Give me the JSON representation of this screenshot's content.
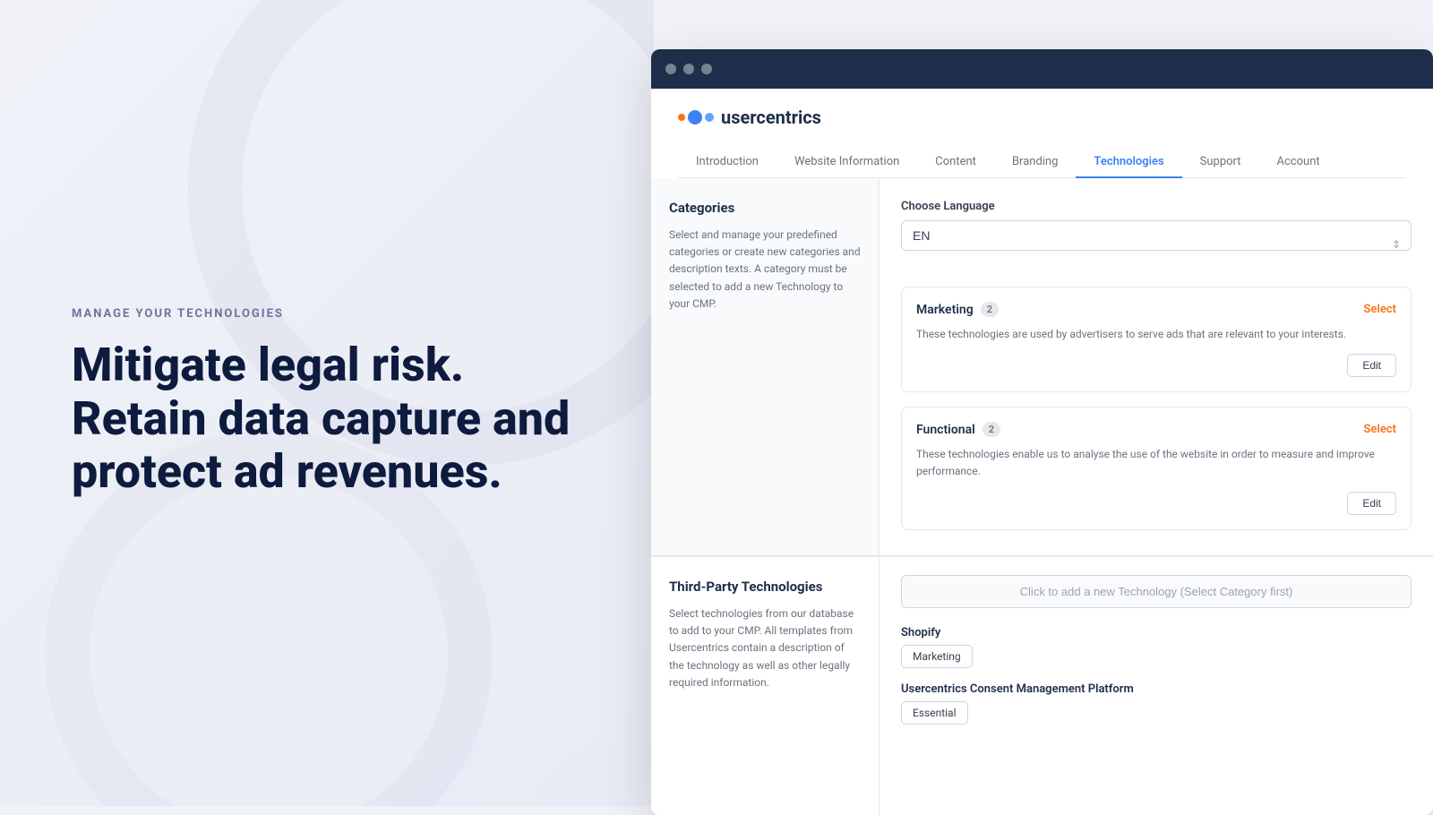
{
  "left": {
    "eyebrow": "MANAGE YOUR TECHNOLOGIES",
    "headline": "Mitigate legal risk. Retain data capture and protect ad revenues."
  },
  "browser": {
    "titlebar": {
      "dots": [
        "dot1",
        "dot2",
        "dot3"
      ]
    },
    "logo": {
      "text_normal": "user",
      "text_bold": "centrics"
    },
    "nav": {
      "tabs": [
        {
          "label": "Introduction",
          "active": false
        },
        {
          "label": "Website Information",
          "active": false
        },
        {
          "label": "Content",
          "active": false
        },
        {
          "label": "Branding",
          "active": false
        },
        {
          "label": "Technologies",
          "active": true
        },
        {
          "label": "Support",
          "active": false
        },
        {
          "label": "Account",
          "active": false
        }
      ]
    },
    "sidebar": {
      "title": "Categories",
      "description": "Select and manage your predefined categories or create new categories and description texts. A category must be selected to add a new Technology to your CMP."
    },
    "content": {
      "choose_language_label": "Choose Language",
      "language_value": "EN",
      "language_placeholder": "EN",
      "categories": [
        {
          "title": "Marketing",
          "badge": "2",
          "select_label": "Select",
          "description": "These technologies are used by advertisers to serve ads that are relevant to your interests.",
          "edit_label": "Edit"
        },
        {
          "title": "Functional",
          "badge": "2",
          "select_label": "Select",
          "description": "These technologies enable us to analyse the use of the website in order to measure and improve performance.",
          "edit_label": "Edit"
        }
      ]
    },
    "third_party": {
      "title": "Third-Party Technologies",
      "description": "Select technologies from our database to add to your CMP. All templates from Usercentrics contain a description of the technology as well as other legally required information."
    },
    "tech_panel": {
      "add_placeholder": "Click to add a new Technology (Select Category first)",
      "technologies": [
        {
          "name": "Shopify",
          "tag": "Marketing"
        },
        {
          "name": "Usercentrics Consent Management Platform",
          "tag": "Essential"
        }
      ]
    }
  }
}
